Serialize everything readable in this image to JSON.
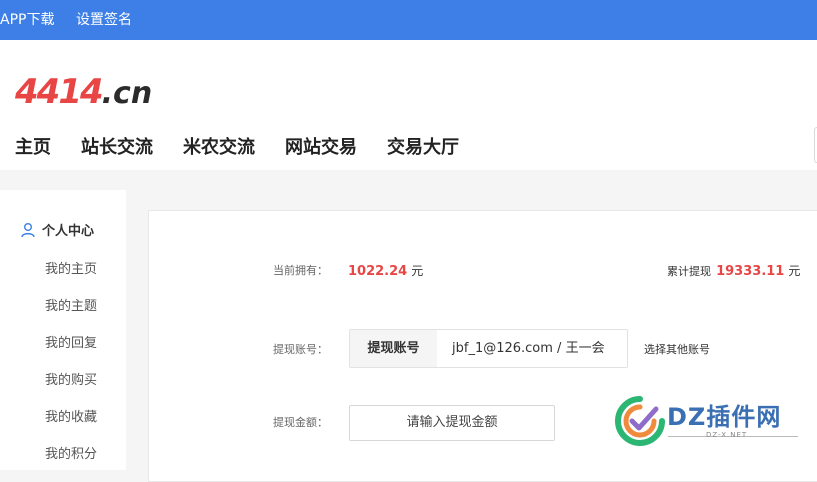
{
  "topbar": {
    "app_download": "APP下载",
    "set_signature": "设置签名"
  },
  "logo": {
    "numeric": "4414",
    "domain": ".cn"
  },
  "nav": {
    "items": [
      "主页",
      "站长交流",
      "米农交流",
      "网站交易",
      "交易大厅"
    ],
    "dropdown_icon": "chevron-down-icon"
  },
  "sidebar": {
    "heading": "个人中心",
    "heading_icon": "user-icon",
    "items": [
      "我的主页",
      "我的主题",
      "我的回复",
      "我的购买",
      "我的收藏",
      "我的积分"
    ]
  },
  "withdraw": {
    "balance_label": "当前拥有：",
    "balance_value": "1022.24",
    "balance_unit": "元",
    "total_label": "累计提现",
    "total_value": "19333.11",
    "total_unit": "元",
    "account_label": "提现账号：",
    "account_tab": "提现账号",
    "account_value": "jbf_1@126.com / 王一会",
    "other_account": "选择其他账号",
    "amount_label": "提现金额：",
    "amount_placeholder": "请输入提现金额"
  },
  "watermark": {
    "text": "DZ插件网",
    "sub": "DZ-X.NET"
  },
  "colors": {
    "brand_blue": "#3d7fe6",
    "accent_red": "#e84545"
  }
}
